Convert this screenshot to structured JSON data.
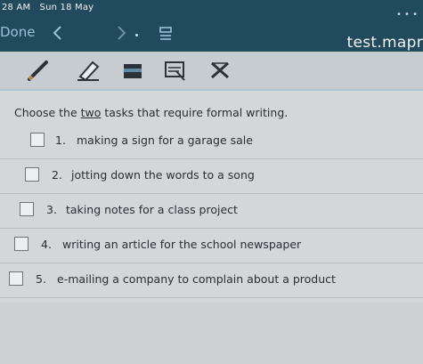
{
  "status_bar": {
    "time": "28 AM",
    "date": "Sun 18 May",
    "dots": "• • •"
  },
  "nav": {
    "done_label": "Done",
    "url": "test.mapr"
  },
  "toolbar": {
    "tools": [
      "pencil-icon",
      "highlighter-icon",
      "eraser-icon",
      "lasso-icon",
      "close-x-icon"
    ]
  },
  "question": {
    "prefix": "Choose the ",
    "emphasis": "two",
    "suffix": " tasks that require formal writing."
  },
  "options": [
    {
      "num": "1.",
      "text": "making a sign for a garage sale"
    },
    {
      "num": "2.",
      "text": "jotting down the words to a song"
    },
    {
      "num": "3.",
      "text": "taking notes for a class project"
    },
    {
      "num": "4.",
      "text": "writing an article for the school newspaper"
    },
    {
      "num": "5.",
      "text": "e-mailing a company to complain about a product"
    }
  ]
}
